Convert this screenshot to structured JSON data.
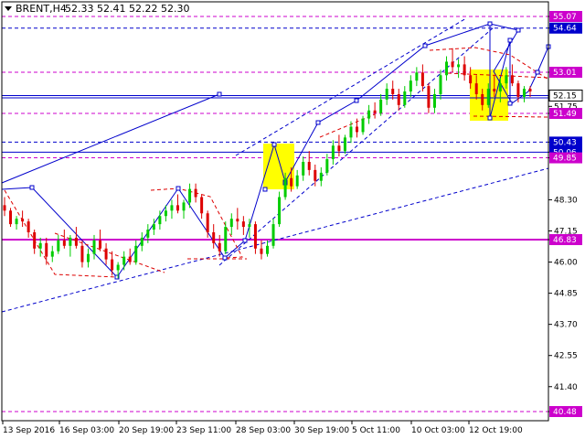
{
  "header": {
    "symbol_label": "BRENT,H4",
    "ohlc": "52.33 52.41 52.22 52.30"
  },
  "colors": {
    "bull": "#00cc00",
    "bear": "#dd0000",
    "analysis": "#0000cc",
    "level": "#cc00cc",
    "pattern": "#ffff00",
    "grid": "#000000"
  },
  "chart_data": {
    "type": "candlestick",
    "symbol": "BRENT",
    "timeframe": "H4",
    "ylim": [
      39.8,
      55.7
    ],
    "yticks": [
      "55.07",
      "54.64",
      "53.01",
      "52.15",
      "51.75",
      "51.49",
      "50.43",
      "50.06",
      "49.85",
      "48.30",
      "47.15",
      "46.83",
      "46.00",
      "44.85",
      "43.70",
      "42.55",
      "41.40",
      "40.48"
    ],
    "xticks": [
      "13 Sep 2016",
      "16 Sep 03:00",
      "20 Sep 19:00",
      "23 Sep 11:00",
      "28 Sep 03:00",
      "30 Sep 19:00",
      "5 Oct 11:00",
      "10 Oct 03:00",
      "12 Oct 19:00"
    ],
    "current_price": 52.15,
    "levels": [
      {
        "price": 55.07,
        "label": "55.07",
        "color": "#cc00cc",
        "style": "dashed"
      },
      {
        "price": 54.64,
        "label": "54.64",
        "color": "#0000cc",
        "style": "dashed"
      },
      {
        "price": 53.01,
        "label": "53.01",
        "color": "#cc00cc",
        "style": "dashed"
      },
      {
        "price": 52.15,
        "label": "52.15",
        "color": "#0000cc",
        "style": "solid"
      },
      {
        "price": 51.49,
        "label": "51.49",
        "color": "#cc00cc",
        "style": "dashed"
      },
      {
        "price": 50.43,
        "label": "50.43",
        "color": "#0000cc",
        "style": "dashed"
      },
      {
        "price": 50.06,
        "label": "50.06",
        "color": "#0000cc",
        "style": "solid"
      },
      {
        "price": 49.85,
        "label": "49.85",
        "color": "#cc00cc",
        "style": "dashed"
      },
      {
        "price": 46.83,
        "label": "46.83",
        "color": "#cc00cc",
        "style": "solid"
      },
      {
        "price": 40.48,
        "label": "40.48",
        "color": "#cc00cc",
        "style": "dashed"
      }
    ],
    "candles": [
      [
        48.1,
        48.4,
        47.7,
        47.9
      ],
      [
        47.9,
        48.0,
        47.3,
        47.4
      ],
      [
        47.4,
        47.7,
        47.2,
        47.6
      ],
      [
        47.6,
        47.9,
        47.3,
        47.5
      ],
      [
        47.5,
        47.6,
        46.9,
        47.1
      ],
      [
        47.1,
        47.2,
        46.3,
        46.5
      ],
      [
        46.5,
        46.9,
        46.2,
        46.7
      ],
      [
        46.7,
        46.9,
        45.9,
        46.2
      ],
      [
        46.2,
        46.6,
        46.0,
        46.4
      ],
      [
        46.4,
        47.0,
        46.3,
        46.8
      ],
      [
        46.8,
        47.2,
        46.5,
        46.6
      ],
      [
        46.6,
        47.0,
        46.2,
        46.9
      ],
      [
        46.9,
        47.3,
        46.5,
        46.6
      ],
      [
        46.6,
        46.8,
        45.8,
        46.0
      ],
      [
        46.0,
        46.5,
        45.8,
        46.3
      ],
      [
        46.3,
        47.0,
        46.1,
        46.8
      ],
      [
        46.8,
        47.2,
        46.4,
        46.5
      ],
      [
        46.5,
        46.7,
        45.9,
        46.1
      ],
      [
        46.1,
        46.4,
        45.5,
        45.7
      ],
      [
        45.7,
        46.0,
        45.4,
        45.9
      ],
      [
        45.9,
        46.4,
        45.7,
        46.2
      ],
      [
        46.2,
        46.5,
        45.9,
        46.0
      ],
      [
        46.0,
        46.8,
        45.9,
        46.6
      ],
      [
        46.6,
        47.1,
        46.4,
        46.9
      ],
      [
        46.9,
        47.4,
        46.7,
        47.2
      ],
      [
        47.2,
        47.6,
        47.0,
        47.4
      ],
      [
        47.4,
        47.9,
        47.2,
        47.7
      ],
      [
        47.7,
        48.1,
        47.5,
        47.9
      ],
      [
        47.9,
        48.3,
        47.6,
        48.1
      ],
      [
        48.1,
        48.5,
        47.8,
        47.9
      ],
      [
        47.9,
        48.3,
        47.6,
        48.2
      ],
      [
        48.2,
        48.9,
        48.0,
        48.7
      ],
      [
        48.7,
        48.9,
        48.2,
        48.4
      ],
      [
        48.4,
        48.5,
        47.6,
        47.8
      ],
      [
        47.8,
        47.9,
        46.9,
        47.1
      ],
      [
        47.1,
        47.4,
        46.5,
        46.7
      ],
      [
        46.7,
        47.0,
        46.2,
        46.4
      ],
      [
        46.4,
        47.5,
        46.3,
        47.3
      ],
      [
        47.3,
        47.8,
        47.0,
        47.6
      ],
      [
        47.6,
        48.0,
        47.2,
        47.5
      ],
      [
        47.5,
        47.7,
        47.0,
        47.3
      ],
      [
        47.3,
        47.6,
        46.9,
        47.4
      ],
      [
        47.4,
        47.5,
        46.3,
        46.5
      ],
      [
        46.5,
        46.8,
        46.1,
        46.3
      ],
      [
        46.3,
        46.8,
        46.2,
        46.6
      ],
      [
        46.6,
        47.6,
        46.5,
        47.4
      ],
      [
        47.4,
        48.6,
        47.3,
        48.4
      ],
      [
        48.4,
        49.3,
        48.3,
        49.1
      ],
      [
        49.1,
        49.5,
        48.6,
        48.8
      ],
      [
        48.8,
        49.4,
        48.7,
        49.2
      ],
      [
        49.2,
        49.9,
        49.0,
        49.7
      ],
      [
        49.7,
        50.1,
        49.2,
        49.4
      ],
      [
        49.4,
        49.6,
        48.8,
        49.0
      ],
      [
        49.0,
        49.5,
        48.8,
        49.3
      ],
      [
        49.3,
        50.0,
        49.2,
        49.8
      ],
      [
        49.8,
        50.5,
        49.6,
        50.3
      ],
      [
        50.3,
        50.7,
        49.9,
        50.1
      ],
      [
        50.1,
        50.7,
        50.0,
        50.6
      ],
      [
        50.6,
        51.2,
        50.4,
        51.0
      ],
      [
        51.0,
        51.3,
        50.6,
        50.8
      ],
      [
        50.8,
        51.4,
        50.7,
        51.3
      ],
      [
        51.3,
        51.8,
        51.1,
        51.6
      ],
      [
        51.6,
        51.9,
        51.3,
        51.5
      ],
      [
        51.5,
        52.2,
        51.4,
        52.0
      ],
      [
        52.0,
        52.6,
        51.8,
        52.4
      ],
      [
        52.4,
        52.7,
        52.0,
        52.2
      ],
      [
        52.2,
        52.4,
        51.6,
        51.8
      ],
      [
        51.8,
        52.5,
        51.7,
        52.3
      ],
      [
        52.3,
        52.9,
        52.1,
        52.7
      ],
      [
        52.7,
        53.2,
        52.5,
        53.0
      ],
      [
        53.0,
        53.3,
        52.3,
        52.5
      ],
      [
        52.5,
        52.6,
        51.5,
        51.7
      ],
      [
        51.7,
        52.4,
        51.5,
        52.2
      ],
      [
        52.2,
        53.1,
        52.0,
        52.9
      ],
      [
        52.9,
        53.6,
        52.7,
        53.4
      ],
      [
        53.4,
        53.9,
        53.0,
        53.2
      ],
      [
        53.2,
        53.5,
        52.8,
        53.3
      ],
      [
        53.3,
        53.6,
        52.7,
        52.9
      ],
      [
        52.9,
        53.2,
        52.4,
        52.6
      ],
      [
        52.6,
        52.9,
        52.0,
        52.2
      ],
      [
        52.2,
        52.4,
        51.6,
        51.8
      ],
      [
        51.8,
        52.6,
        51.7,
        52.4
      ],
      [
        52.4,
        52.9,
        52.1,
        52.3
      ],
      [
        52.3,
        52.8,
        51.9,
        52.6
      ],
      [
        52.6,
        53.2,
        52.4,
        52.9
      ],
      [
        52.9,
        53.3,
        52.5,
        52.6
      ],
      [
        52.6,
        52.7,
        51.9,
        52.1
      ],
      [
        52.1,
        52.5,
        51.9,
        52.4
      ],
      [
        52.4,
        52.5,
        52.1,
        52.3
      ]
    ]
  }
}
